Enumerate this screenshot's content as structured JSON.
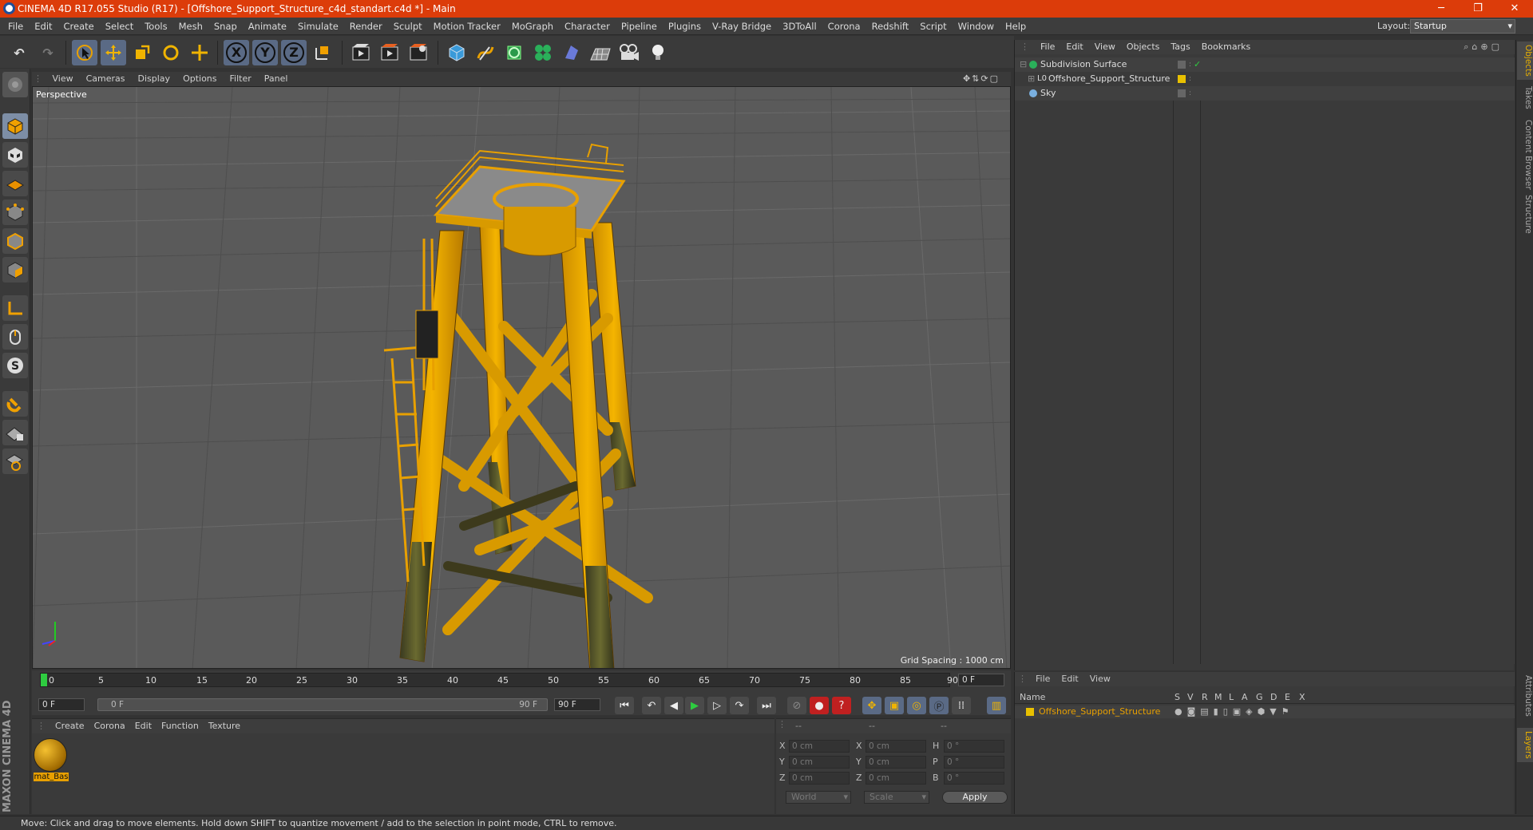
{
  "window": {
    "title": "CINEMA 4D R17.055 Studio (R17) - [Offshore_Support_Structure_c4d_standart.c4d *] - Main",
    "layout_label": "Layout:",
    "layout_value": "Startup"
  },
  "menu": [
    "File",
    "Edit",
    "Create",
    "Select",
    "Tools",
    "Mesh",
    "Snap",
    "Animate",
    "Simulate",
    "Render",
    "Sculpt",
    "Motion Tracker",
    "MoGraph",
    "Character",
    "Pipeline",
    "Plugins",
    "V-Ray Bridge",
    "3DToAll",
    "Corona",
    "Redshift",
    "Script",
    "Window",
    "Help"
  ],
  "toolbar": {
    "x_axis": "X",
    "y_axis": "Y",
    "z_axis": "Z"
  },
  "viewport": {
    "menu": [
      "View",
      "Cameras",
      "Display",
      "Options",
      "Filter",
      "Panel"
    ],
    "label": "Perspective",
    "grid_spacing": "Grid Spacing : 1000 cm"
  },
  "timeline": {
    "ticks": [
      "0",
      "5",
      "10",
      "15",
      "20",
      "25",
      "30",
      "35",
      "40",
      "45",
      "50",
      "55",
      "60",
      "65",
      "70",
      "75",
      "80",
      "85",
      "90"
    ],
    "current_frame": "0 F",
    "start_frame": "0 F",
    "range_start": "0 F",
    "range_end": "90 F",
    "end_frame": "90 F"
  },
  "material_panel": {
    "menu": [
      "Create",
      "Corona",
      "Edit",
      "Function",
      "Texture"
    ],
    "material_name": "mat_Bas"
  },
  "coords": {
    "header": [
      "--",
      "--",
      "--"
    ],
    "rows": [
      {
        "a": "X",
        "av": "0 cm",
        "b": "X",
        "bv": "0 cm",
        "c": "H",
        "cv": "0 °"
      },
      {
        "a": "Y",
        "av": "0 cm",
        "b": "Y",
        "bv": "0 cm",
        "c": "P",
        "cv": "0 °"
      },
      {
        "a": "Z",
        "av": "0 cm",
        "b": "Z",
        "bv": "0 cm",
        "c": "B",
        "cv": "0 °"
      }
    ],
    "world": "World",
    "scale": "Scale",
    "apply": "Apply"
  },
  "object_manager": {
    "menu": [
      "File",
      "Edit",
      "View",
      "Objects",
      "Tags",
      "Bookmarks"
    ],
    "objects": [
      "Subdivision Surface",
      "Offshore_Support_Structure",
      "Sky"
    ]
  },
  "layer_manager": {
    "menu": [
      "File",
      "Edit",
      "View"
    ],
    "name_header": "Name",
    "columns": [
      "S",
      "V",
      "R",
      "M",
      "L",
      "A",
      "G",
      "D",
      "E",
      "X"
    ],
    "layer": "Offshore_Support_Structure"
  },
  "side_tabs": [
    "Objects",
    "Takes",
    "Content Browser",
    "Structure"
  ],
  "side_tabs_bottom": [
    "Attributes",
    "Layers"
  ],
  "status": "Move: Click and drag to move elements. Hold down SHIFT to quantize movement / add to the selection in point mode, CTRL to remove.",
  "brand": "MAXON CINEMA 4D",
  "colors": {
    "title_bar": "#dc3c0a",
    "object_color": "#e8c000",
    "accent": "#e8a000"
  }
}
